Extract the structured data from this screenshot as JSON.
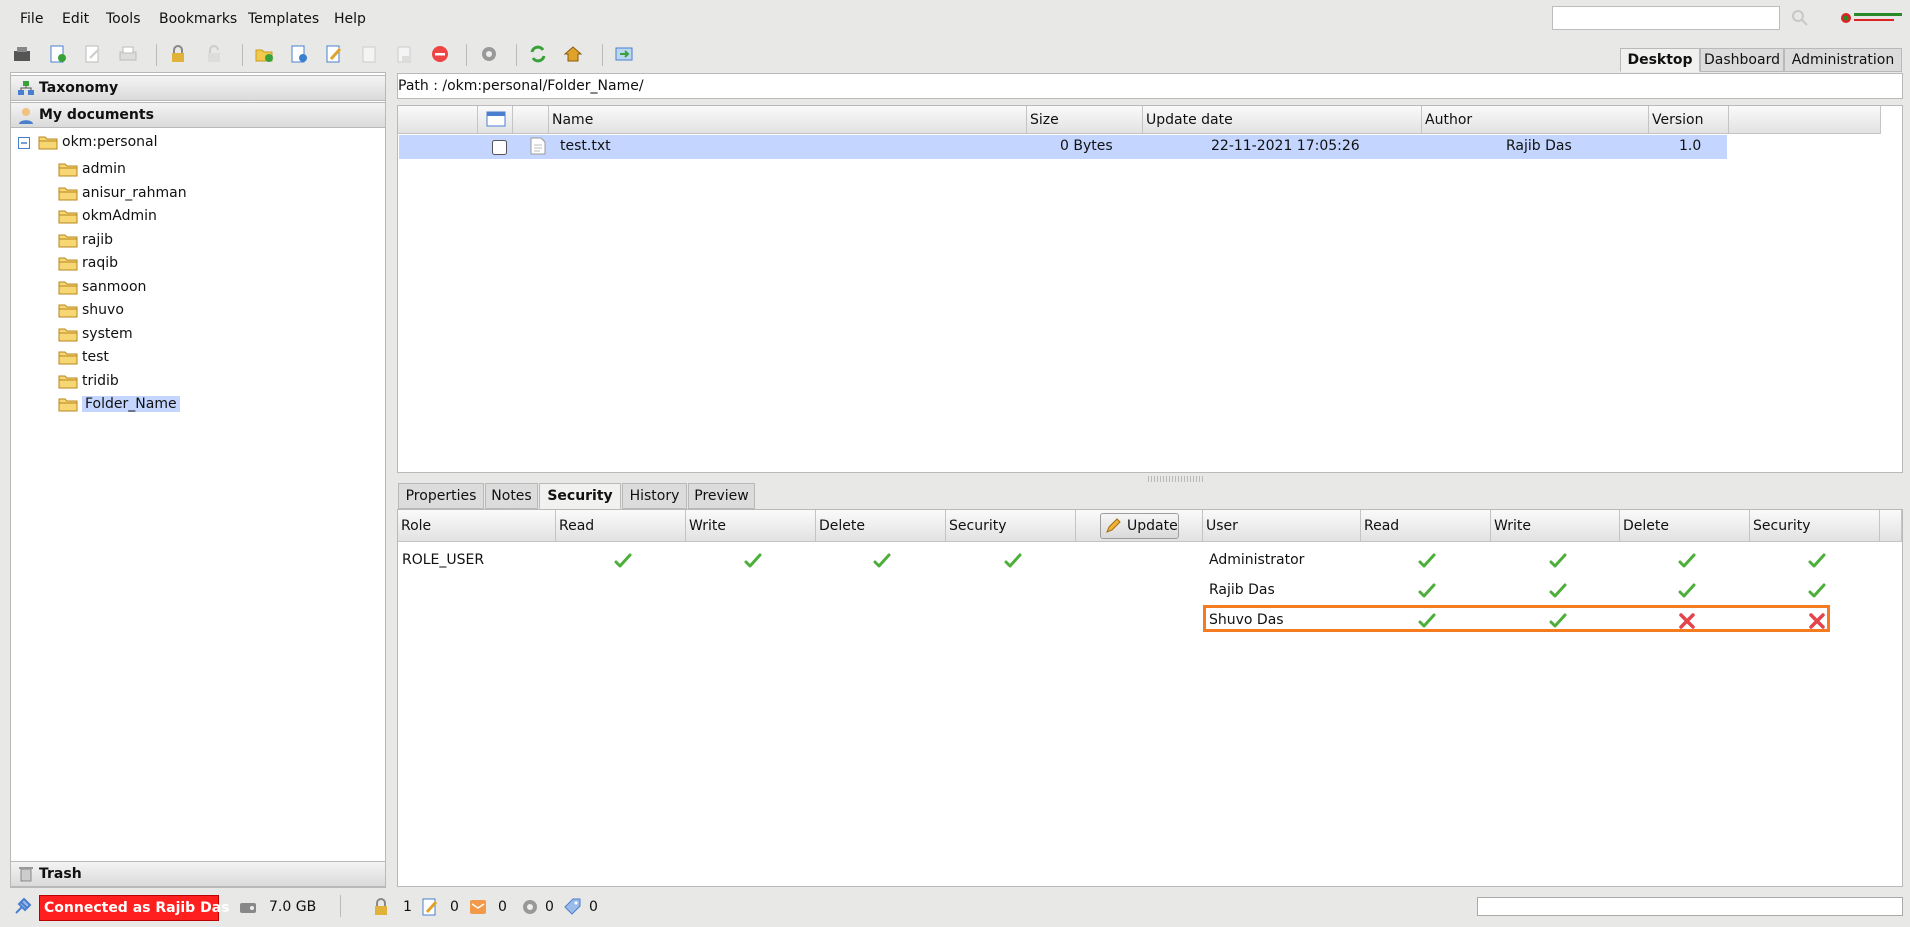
{
  "menu": {
    "items": [
      "File",
      "Edit",
      "Tools",
      "Bookmarks",
      "Templates",
      "Help"
    ]
  },
  "search": {
    "value": "",
    "placeholder": ""
  },
  "top_tabs": [
    {
      "label": "Desktop",
      "active": true
    },
    {
      "label": "Dashboard",
      "active": false
    },
    {
      "label": "Administration",
      "active": false
    }
  ],
  "toolbar": {
    "icons": [
      "scanner-icon",
      "add-document-icon",
      "edit-document-icon",
      "print-icon",
      "lock-icon",
      "unlock-icon",
      "new-folder-icon",
      "add-file-icon",
      "edit-icon",
      "copy-icon",
      "paste-icon",
      "delete-icon",
      "settings-icon",
      "refresh-icon",
      "home-icon",
      "exit-icon"
    ]
  },
  "left": {
    "taxonomy_label": "Taxonomy",
    "my_documents_label": "My documents",
    "trash_label": "Trash",
    "root": "okm:personal",
    "folders": [
      "admin",
      "anisur_rahman",
      "okmAdmin",
      "rajib",
      "raqib",
      "sanmoon",
      "shuvo",
      "system",
      "test",
      "tridib",
      "Folder_Name"
    ],
    "selected": "Folder_Name"
  },
  "path": {
    "text": "Path : /okm:personal/Folder_Name/"
  },
  "file_list": {
    "columns": [
      "Name",
      "Size",
      "Update date",
      "Author",
      "Version"
    ],
    "rows": [
      {
        "name": "test.txt",
        "size": "0 Bytes",
        "updated": "22-11-2021 17:05:26",
        "author": "Rajib Das",
        "version": "1.0"
      }
    ]
  },
  "bottom_tabs": [
    {
      "label": "Properties",
      "active": false
    },
    {
      "label": "Notes",
      "active": false
    },
    {
      "label": "Security",
      "active": true
    },
    {
      "label": "History",
      "active": false
    },
    {
      "label": "Preview",
      "active": false
    }
  ],
  "security": {
    "update_label": "Update",
    "role_columns": [
      "Role",
      "Read",
      "Write",
      "Delete",
      "Security"
    ],
    "user_columns": [
      "User",
      "Read",
      "Write",
      "Delete",
      "Security"
    ],
    "roles": [
      {
        "name": "ROLE_USER",
        "read": true,
        "write": true,
        "delete": true,
        "security": true
      }
    ],
    "users": [
      {
        "name": "Administrator",
        "read": true,
        "write": true,
        "delete": true,
        "security": true
      },
      {
        "name": "Rajib Das",
        "read": true,
        "write": true,
        "delete": true,
        "security": true
      },
      {
        "name": "Shuvo Das",
        "read": true,
        "write": true,
        "delete": false,
        "security": false
      }
    ],
    "highlighted_user": "Shuvo Das",
    "highlight_color": "#f47b20"
  },
  "status": {
    "connected_label": "Connected as Rajib Das",
    "storage": "7.0 GB",
    "locked_count": "1",
    "checkout_count": "0",
    "mail_count": "0",
    "workflow_count": "0",
    "tasks_count": "0"
  }
}
